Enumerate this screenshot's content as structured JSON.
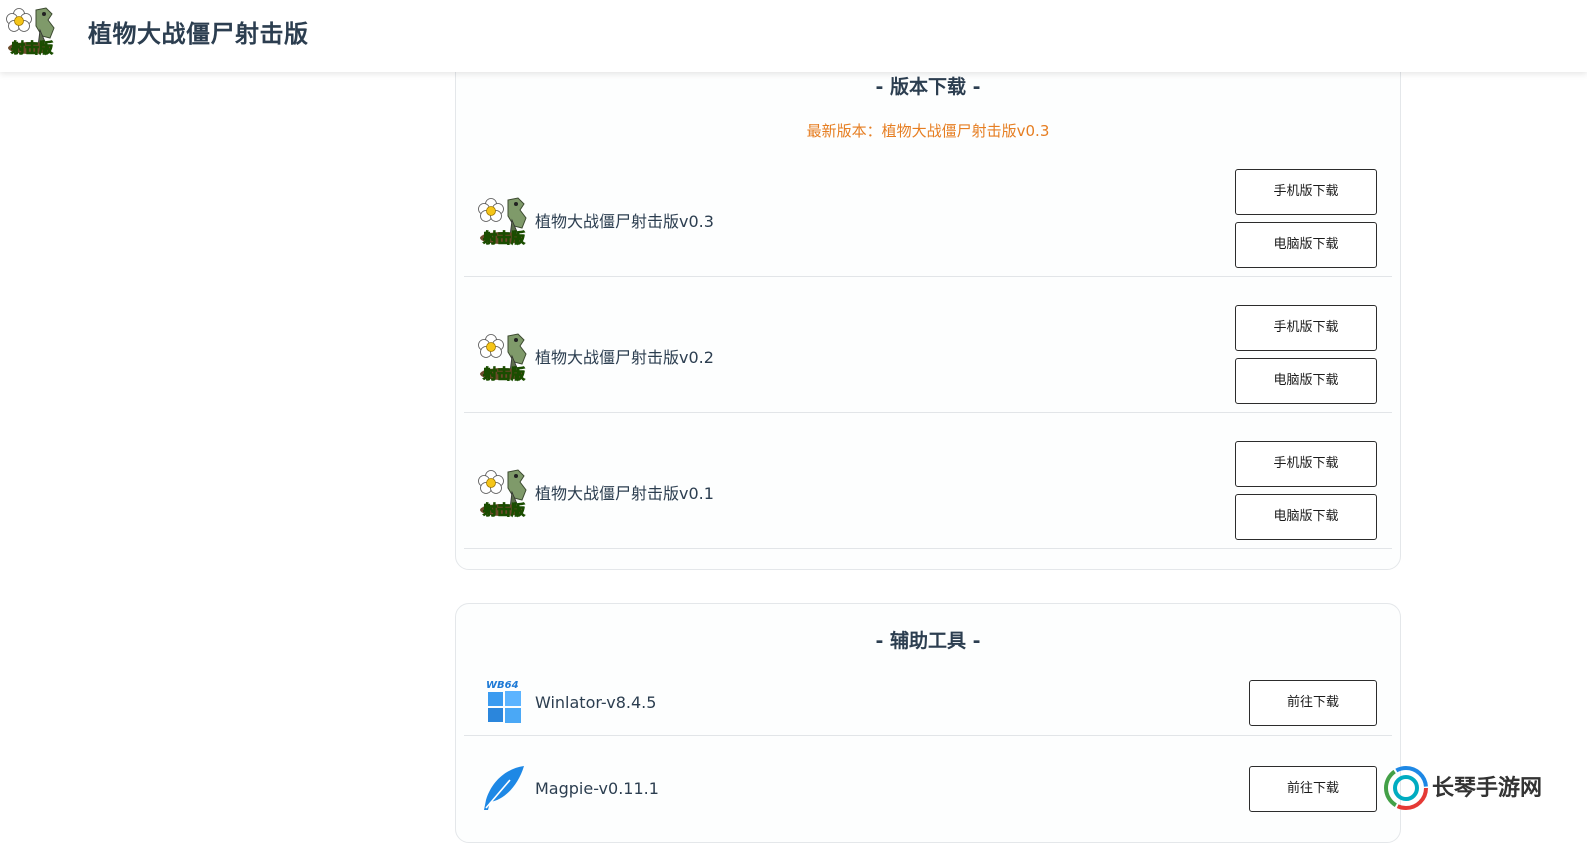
{
  "header": {
    "site_title": "植物大战僵尸射击版"
  },
  "versions": {
    "title": "- 版本下载 -",
    "latest_label": "最新版本：植物大战僵尸射击版v0.3",
    "items": [
      {
        "name": "植物大战僵尸射击版v0.3",
        "mobile_label": "手机版下载",
        "pc_label": "电脑版下载"
      },
      {
        "name": "植物大战僵尸射击版v0.2",
        "mobile_label": "手机版下载",
        "pc_label": "电脑版下载"
      },
      {
        "name": "植物大战僵尸射击版v0.1",
        "mobile_label": "手机版下载",
        "pc_label": "电脑版下载"
      }
    ]
  },
  "tools": {
    "title": "- 辅助工具 -",
    "items": [
      {
        "name": "Winlator-v8.4.5",
        "button_label": "前往下载",
        "icon_text": "WB64"
      },
      {
        "name": "Magpie-v0.11.1",
        "button_label": "前往下载"
      }
    ]
  },
  "watermark": {
    "text": "长琴手游网"
  },
  "colors": {
    "accent_orange": "#e67e22",
    "title_text": "#2c3e50",
    "border": "#e4e7ea"
  }
}
